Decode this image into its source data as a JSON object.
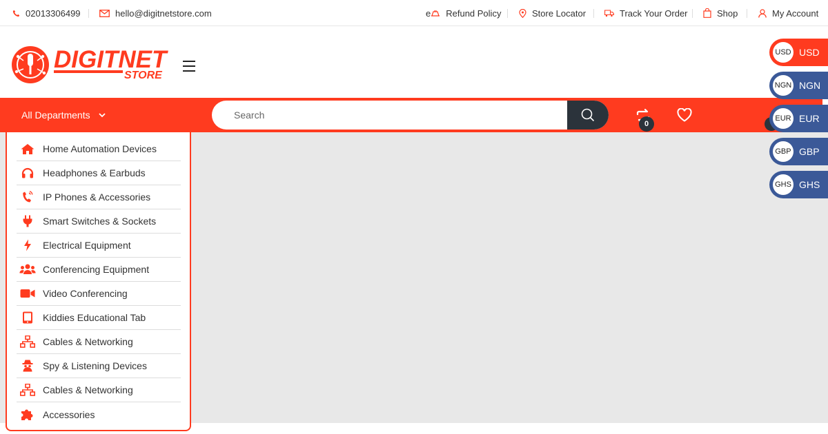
{
  "topbar": {
    "phone": "02013306499",
    "email": "hello@digitnetstore.com",
    "links": [
      {
        "label": "Refund Policy",
        "icon": "refund-icon",
        "prefix": "e"
      },
      {
        "label": "Store Locator",
        "icon": "location-pin-icon"
      },
      {
        "label": "Track Your Order",
        "icon": "truck-icon"
      },
      {
        "label": "Shop",
        "icon": "shopping-bag-icon"
      },
      {
        "label": "My Account",
        "icon": "user-icon"
      }
    ]
  },
  "brand": {
    "name_main": "DIGITNET",
    "name_sub": "STORE",
    "accent_color": "#ff3b1f",
    "dark_color": "#2b333b"
  },
  "nav": {
    "departments_label": "All Departments",
    "search_placeholder": "Search",
    "compare_count": "0"
  },
  "departments": [
    {
      "label": "Home Automation Devices",
      "icon": "home-icon"
    },
    {
      "label": "Headphones & Earbuds",
      "icon": "headphones-icon"
    },
    {
      "label": "IP Phones & Accessories",
      "icon": "phone-volume-icon"
    },
    {
      "label": "Smart Switches & Sockets",
      "icon": "plug-icon"
    },
    {
      "label": "Electrical Equipment",
      "icon": "bolt-icon"
    },
    {
      "label": "Conferencing Equipment",
      "icon": "users-icon"
    },
    {
      "label": "Video Conferencing",
      "icon": "video-camera-icon"
    },
    {
      "label": "Kiddies Educational Tab",
      "icon": "tablet-icon"
    },
    {
      "label": "Cables & Networking",
      "icon": "network-icon"
    },
    {
      "label": "Spy & Listening Devices",
      "icon": "spy-icon"
    },
    {
      "label": "Cables & Networking",
      "icon": "network-icon"
    },
    {
      "label": "Accessories",
      "icon": "puzzle-icon"
    }
  ],
  "currencies": [
    {
      "code": "USD",
      "label": "USD",
      "color": "#ff3b1f"
    },
    {
      "code": "NGN",
      "label": "NGN",
      "color": "#3b5998"
    },
    {
      "code": "EUR",
      "label": "EUR",
      "color": "#3b5998"
    },
    {
      "code": "GBP",
      "label": "GBP",
      "color": "#3b5998"
    },
    {
      "code": "GHS",
      "label": "GHS",
      "color": "#3b5998"
    }
  ]
}
